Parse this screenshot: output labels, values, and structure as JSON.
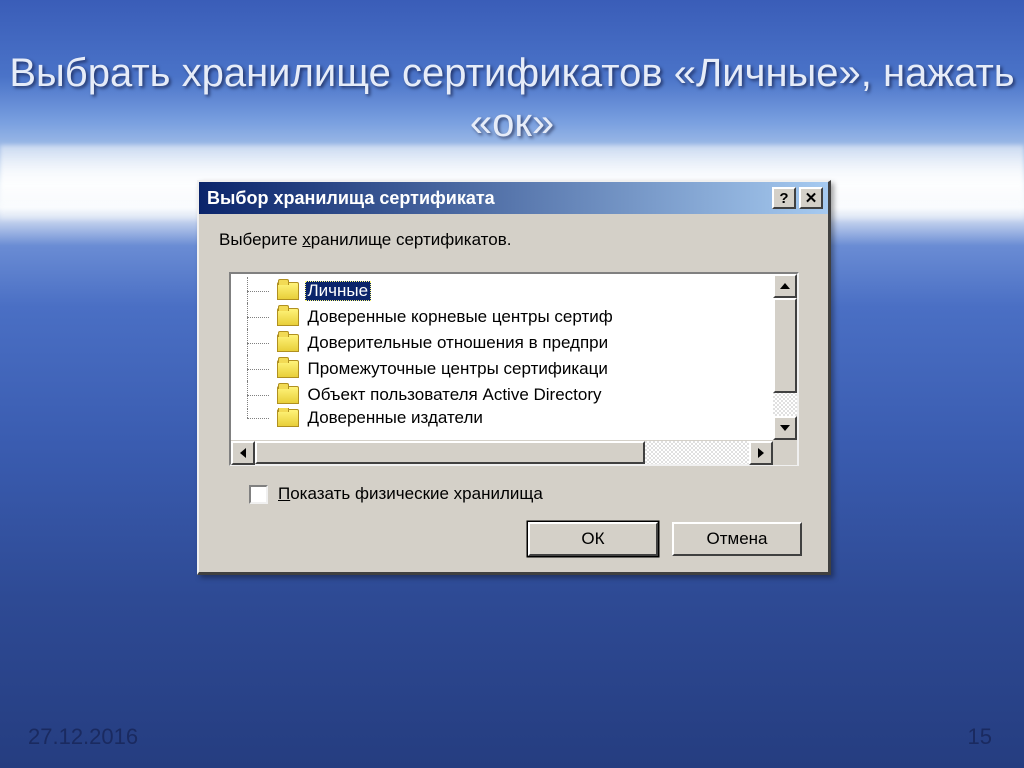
{
  "slide": {
    "title": "Выбрать хранилище сертификатов «Личные», нажать «ок»",
    "date": "27.12.2016",
    "page": "15"
  },
  "dialog": {
    "title": "Выбор хранилища сертификата",
    "help_glyph": "?",
    "close_glyph": "✕",
    "instruction_pre": "Выберите ",
    "instruction_hotkey": "х",
    "instruction_post": "ранилище сертификатов.",
    "tree": {
      "items": [
        {
          "label": "Личные",
          "selected": true
        },
        {
          "label": "Доверенные корневые центры сертиф",
          "selected": false
        },
        {
          "label": "Доверительные отношения в предпри",
          "selected": false
        },
        {
          "label": "Промежуточные центры сертификаци",
          "selected": false
        },
        {
          "label": "Объект пользователя Active Directory",
          "selected": false
        },
        {
          "label": "Доверенные издатели",
          "selected": false
        }
      ]
    },
    "checkbox_pre": "",
    "checkbox_hotkey": "П",
    "checkbox_post": "оказать физические хранилища",
    "checkbox_checked": false,
    "ok_label": "ОК",
    "cancel_label": "Отмена"
  }
}
